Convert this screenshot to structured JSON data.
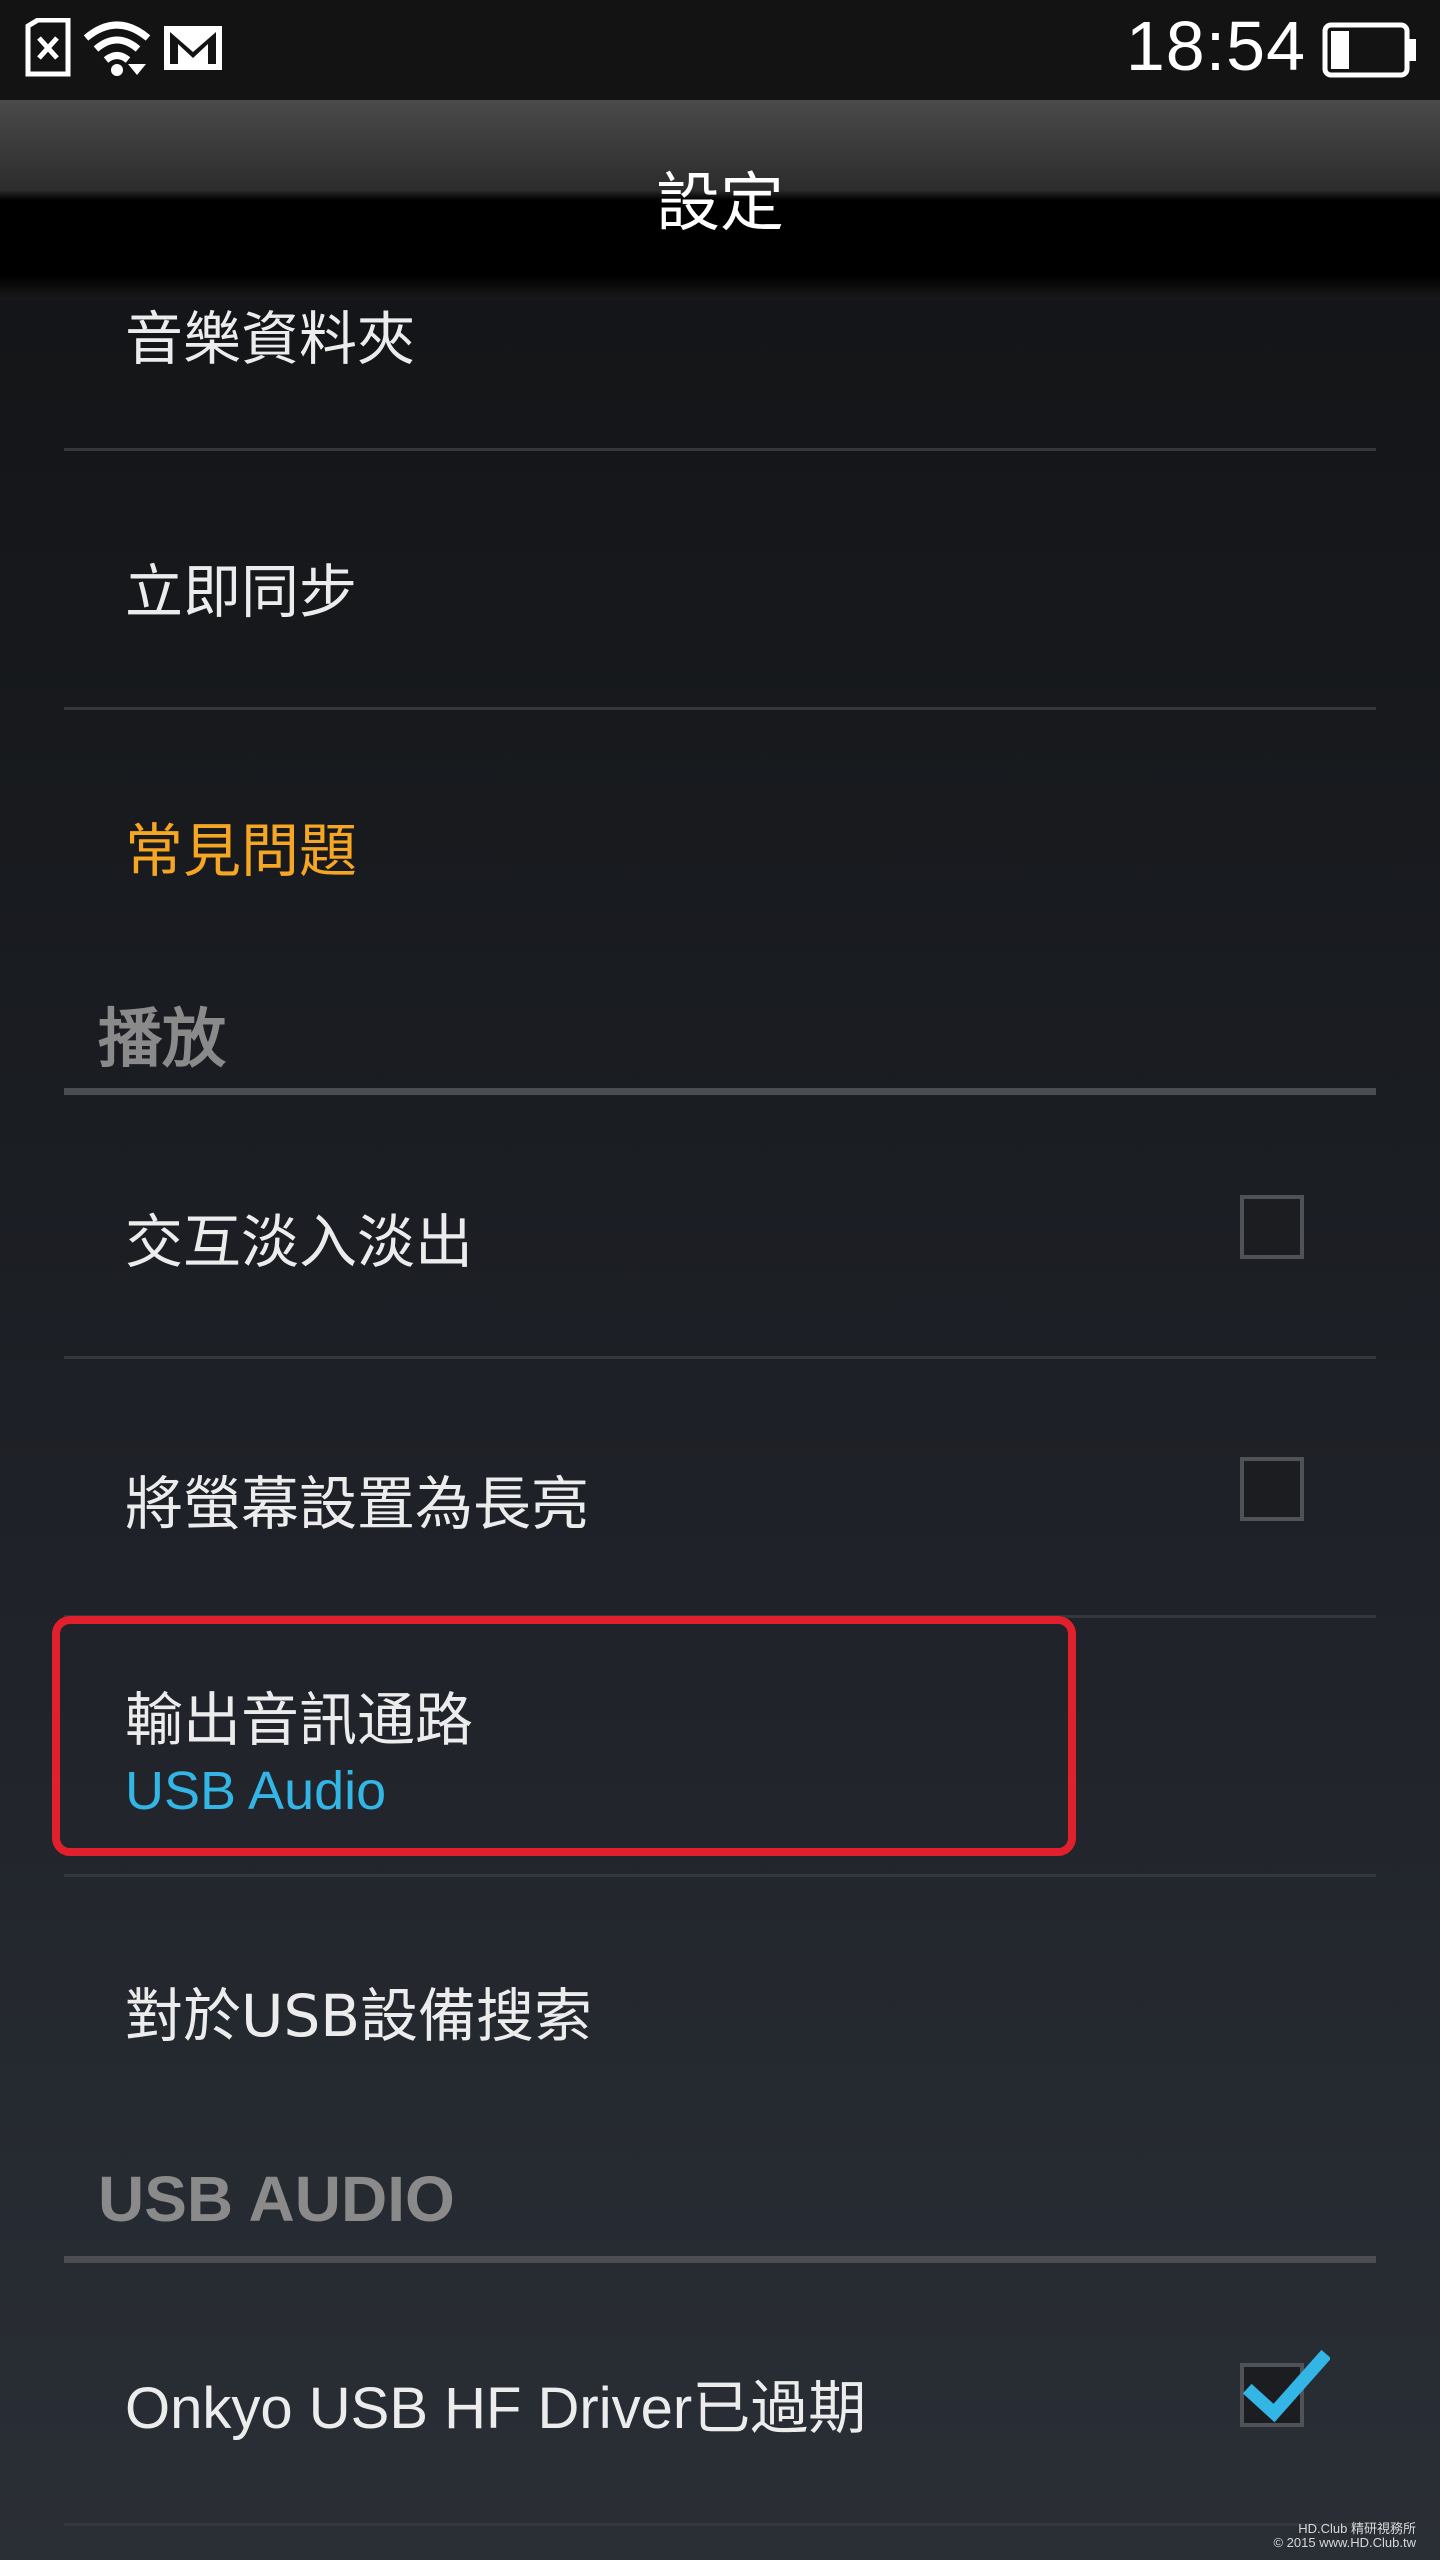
{
  "status_bar": {
    "time": "18:54",
    "icons": [
      "sim-card-icon",
      "wifi-icon",
      "gmail-icon",
      "battery-icon"
    ]
  },
  "action_bar": {
    "title": "設定"
  },
  "settings": {
    "music_folder": "音樂資料夾",
    "sync_now": "立即同步",
    "faq": "常見問題",
    "section_playback": "播放",
    "crossfade": {
      "label": "交互淡入淡出",
      "checked": false
    },
    "keep_screen_on": {
      "label": "將螢幕設置為長亮",
      "checked": false
    },
    "output_route": {
      "label": "輸出音訊通路",
      "value": "USB Audio"
    },
    "usb_search": "對於USB設備搜索",
    "section_usb_audio": "USB AUDIO",
    "onkyo_driver": {
      "label": "Onkyo USB HF Driver已過期",
      "checked": true
    }
  },
  "watermark": {
    "line1": "HD.Club 精研視務所",
    "line2": "© 2015  www.HD.Club.tw"
  },
  "colors": {
    "accent_orange": "#f5a623",
    "accent_blue": "#33b5e5",
    "highlight_red": "#e0202d",
    "section_header": "#8a8a8a"
  }
}
